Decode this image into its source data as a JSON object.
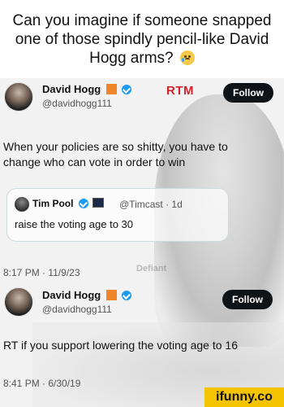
{
  "caption": {
    "text": "Can you imagine if someone snapped one of those spindly pencil-like David Hogg arms?",
    "emoji": "crying-face"
  },
  "tweet1": {
    "name": "David Hogg",
    "handle": "@davidhogg111",
    "badge": "RTM",
    "follow_label": "Follow",
    "text": "When your policies are so shitty, you have to change who can vote in order to win",
    "quote": {
      "name": "Tim Pool",
      "handle": "@Timcast · 1d",
      "text": "raise the voting age to 30"
    },
    "timestamp": "8:17 PM · 11/9/23"
  },
  "tweet2": {
    "name": "David Hogg",
    "handle": "@davidhogg111",
    "follow_label": "Follow",
    "text": "RT if you support lowering the voting age to 16",
    "timestamp": "8:41 PM · 6/30/19"
  },
  "watermark": "Defiant",
  "ifunny_label": "ifunny.co",
  "colors": {
    "verified": "#1d9bf0",
    "follow_button": "#0f1419",
    "rtm": "#d62027",
    "ifunny_bg": "#f5c400"
  }
}
